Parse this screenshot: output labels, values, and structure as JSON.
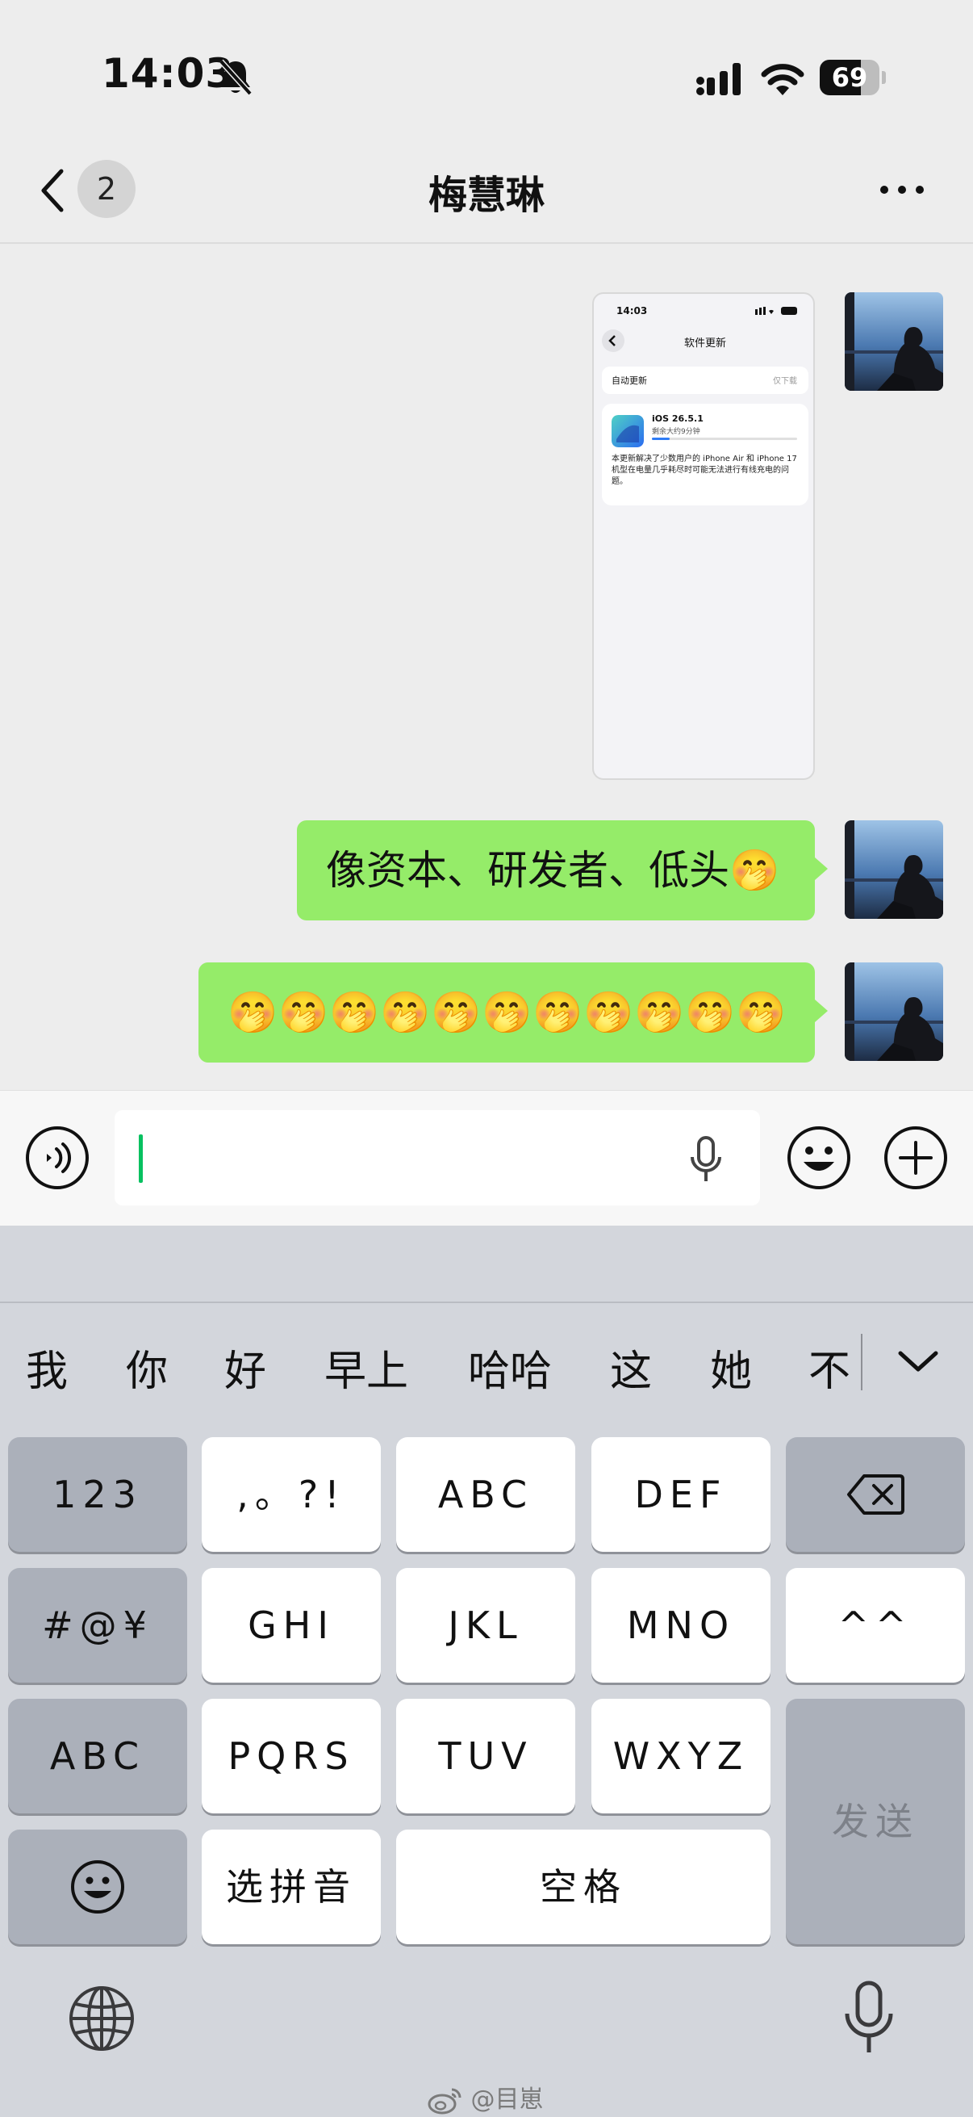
{
  "status_bar": {
    "time": "14:03",
    "battery_percent": "69",
    "battery_level": 0.69
  },
  "nav": {
    "unread_count": "2",
    "title": "梅慧琳"
  },
  "messages": [
    {
      "type": "image",
      "screenshot": {
        "time": "14:03",
        "title": "软件更新",
        "auto_update_label": "自动更新",
        "auto_update_value": "仅下载",
        "version": "iOS 26.5.1",
        "remaining": "剩余大约9分钟",
        "progress": 0.12,
        "description": "本更新解决了少数用户的 iPhone Air 和 iPhone 17 机型在电量几乎耗尽时可能无法进行有线充电的问题。"
      }
    },
    {
      "type": "text",
      "text": "像资本、研发者、低头🤭"
    },
    {
      "type": "emoji",
      "emoji": "🤭",
      "count": 11
    }
  ],
  "input": {
    "placeholder": ""
  },
  "keyboard": {
    "candidates": [
      "我",
      "你",
      "好",
      "早上",
      "哈哈",
      "这",
      "她",
      "不"
    ],
    "keys": {
      "k123": "123",
      "punct": ",。?!",
      "abc1": "ABC",
      "def": "DEF",
      "symbols": "#@¥",
      "ghi": "GHI",
      "jkl": "JKL",
      "mno": "MNO",
      "caret": "^^",
      "abc_mode": "ABC",
      "pqrs": "PQRS",
      "tuv": "TUV",
      "wxyz": "WXYZ",
      "send": "发送",
      "pinyin": "选拼音",
      "space": "空格"
    }
  },
  "watermark": "@目崽",
  "colors": {
    "bubble": "#95ec69",
    "cursor": "#07c160",
    "background": "#ededed",
    "keyboard": "#d3d6dc"
  },
  "icons": [
    "bell-slash-icon",
    "signal-icon",
    "wifi-icon",
    "back-icon",
    "more-icon",
    "voice-icon",
    "mic-icon",
    "emoji-icon",
    "plus-icon",
    "delete-icon",
    "smiley-icon",
    "globe-icon",
    "chevron-down-icon",
    "weibo-icon"
  ]
}
